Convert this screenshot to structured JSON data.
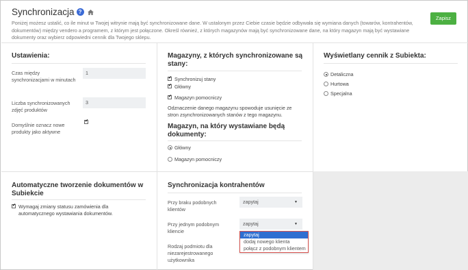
{
  "header": {
    "title": "Synchronizacja",
    "help_icon": "?",
    "description": "Poniżej możesz ustalić, co ile minut w Twojej witrynie mają być synchronizowane dane. W ustalonym przez Ciebie czasie będzie odbywała się wymiana danych (towarów, kontrahentów, dokumentów) między vendero a programem, z którym jest połączone. Określ również, z których magazynów mają być synchronizowane dane, na który magazyn mają być wystawiane dokumenty oraz wybierz odpowiedni cennik dla Twojego sklepu.",
    "save_label": "Zapisz"
  },
  "settings": {
    "heading": "Ustawienia:",
    "interval_label": "Czas między synchronizacjami w minutach",
    "interval_value": "1",
    "photos_label": "Liczba synchronizowanych zdjęć produktów",
    "photos_value": "3",
    "active_label": "Domyślnie oznacz nowe produkty jako aktywne",
    "active_checked": true
  },
  "warehouses": {
    "heading": "Magazyny, z których synchronizowane są stany:",
    "items": [
      {
        "label": "Synchronizuj stany",
        "checked": true
      },
      {
        "label": "Główny",
        "checked": true
      },
      {
        "label": "Magazyn pomocniczy",
        "checked": true
      }
    ],
    "note": "Odznaczenie danego magazynu spowoduje usunięcie ze stron zsynchronizowanych stanów z tego magazynu.",
    "doc_heading": "Magazyn, na który wystawiane będą dokumenty:",
    "doc_options": [
      {
        "label": "Główny",
        "selected": true
      },
      {
        "label": "Magazyn pomocniczy",
        "selected": false
      }
    ]
  },
  "pricelist": {
    "heading": "Wyświetlany cennik z Subiekta:",
    "options": [
      {
        "label": "Detaliczna",
        "selected": true
      },
      {
        "label": "Hurtowa",
        "selected": false
      },
      {
        "label": "Specjalna",
        "selected": false
      }
    ]
  },
  "autodocs": {
    "heading": "Automatyczne tworzenie dokumentów w Subiekcie",
    "require_label": "Wymagaj zmiany statusu zamówienia dla automatycznego wystawiania dokumentów.",
    "require_checked": true
  },
  "contractors": {
    "heading": "Synchronizacja kontrahentów",
    "no_similar_label": "Przy braku podobnych klientów",
    "no_similar_value": "zapytaj",
    "one_similar_label": "Przy jednym podobnym kliencie",
    "one_similar_value": "zapytaj",
    "dropdown_options": [
      "zapytaj",
      "dodaj nowego klienta",
      "połącz z podobnym klientem"
    ],
    "entity_label": "Rodzaj podmiotu dla niezarejestrowanego użytkownika"
  }
}
